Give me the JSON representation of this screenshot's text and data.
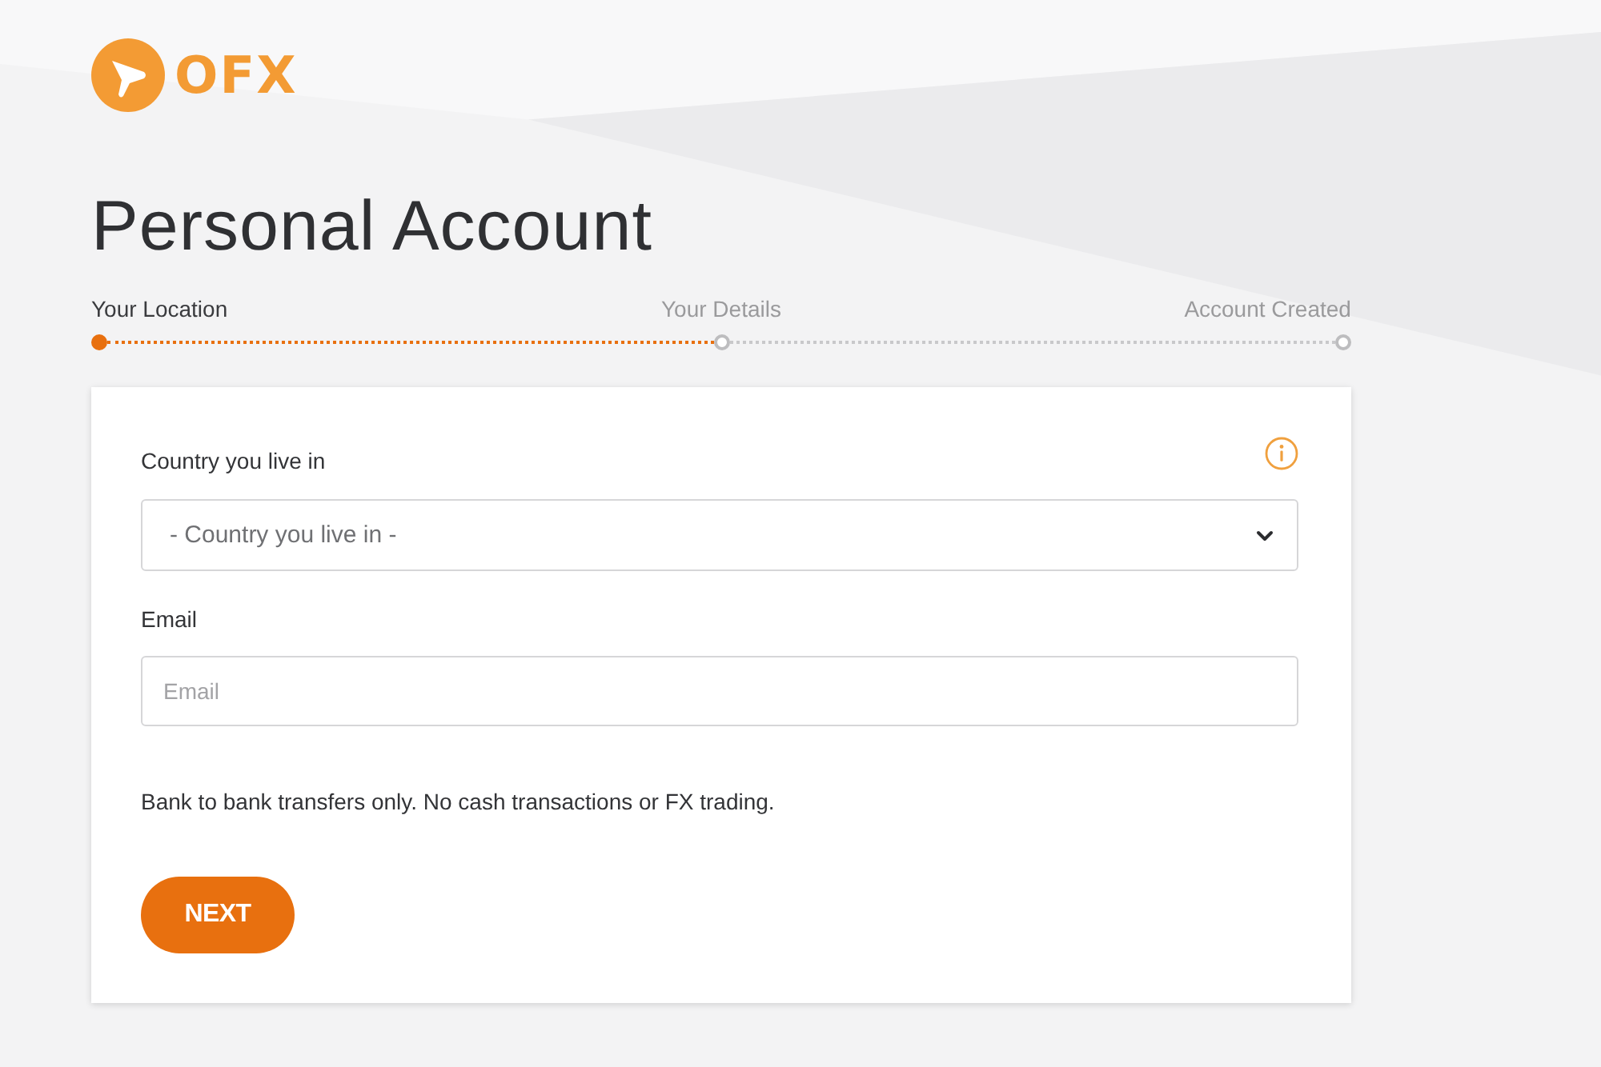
{
  "logo": {
    "text": "OFX"
  },
  "title": "Personal Account",
  "steps": [
    {
      "label": "Your Location",
      "selected": true
    },
    {
      "label": "Your Details",
      "selected": false
    },
    {
      "label": "Account Created",
      "selected": false
    }
  ],
  "form": {
    "fields": [
      {
        "kind": "select",
        "label": "Country you live in",
        "placeholder": "- Country you live in -",
        "info": true
      },
      {
        "kind": "input",
        "label": "Email",
        "placeholder": "Email"
      }
    ],
    "notice": "Bank to bank transfers only. No cash transactions or FX trading.",
    "button": "NEXT"
  }
}
